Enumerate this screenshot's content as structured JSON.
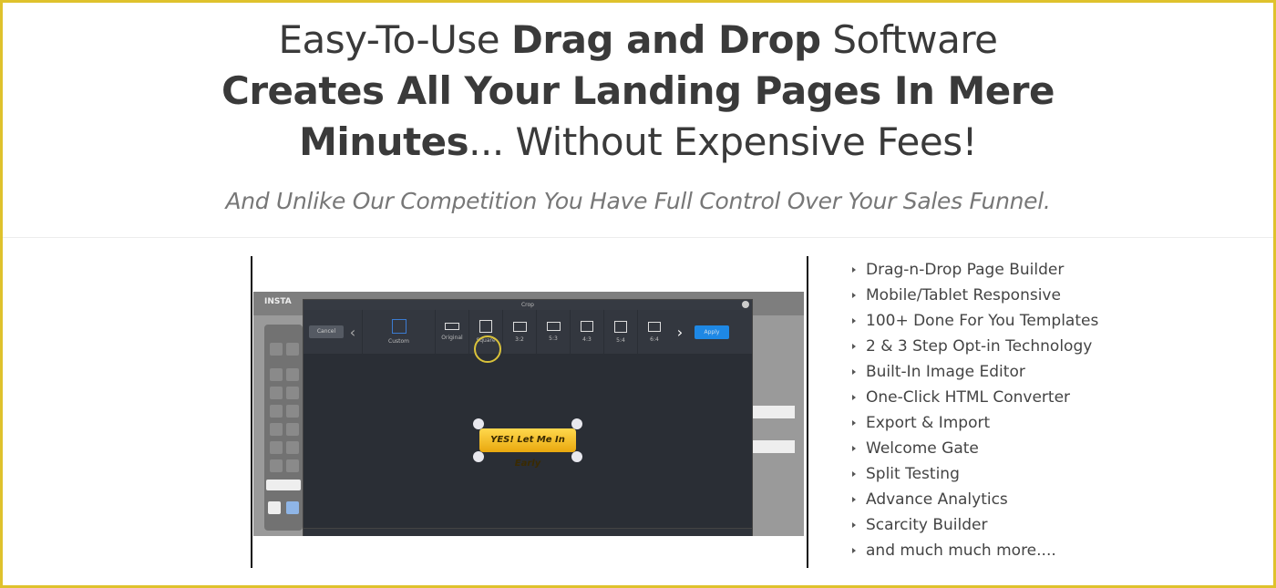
{
  "headline": {
    "l1a": "Easy-To-Use ",
    "l1b": "Drag and Drop",
    "l1c": " Software",
    "l2": "Creates All Your Landing Pages In Mere",
    "l3a": "Minutes",
    "l3b": "... Without Expensive Fees!"
  },
  "subtitle": "And Unlike Our Competition You Have Full Control Over Your Sales Funnel.",
  "screenshot": {
    "logo": "INSTA",
    "modal_title": "Crop",
    "cancel": "Cancel",
    "apply": "Apply",
    "options": [
      "Custom",
      "Original",
      "Square",
      "3:2",
      "5:3",
      "4:3",
      "5:4",
      "6:4"
    ],
    "button_text": "YES! Let Me In Early"
  },
  "features": [
    "Drag-n-Drop Page Builder",
    "Mobile/Tablet Responsive",
    "100+ Done For You Templates",
    "2 & 3 Step Opt-in Technology",
    "Built-In Image Editor",
    "One-Click HTML Converter",
    "Export & Import",
    "Welcome Gate",
    "Split Testing",
    "Advance Analytics",
    "Scarcity Builder",
    "and much much more...."
  ],
  "colors": {
    "border": "#dfc22c",
    "apply": "#1e88e5"
  }
}
